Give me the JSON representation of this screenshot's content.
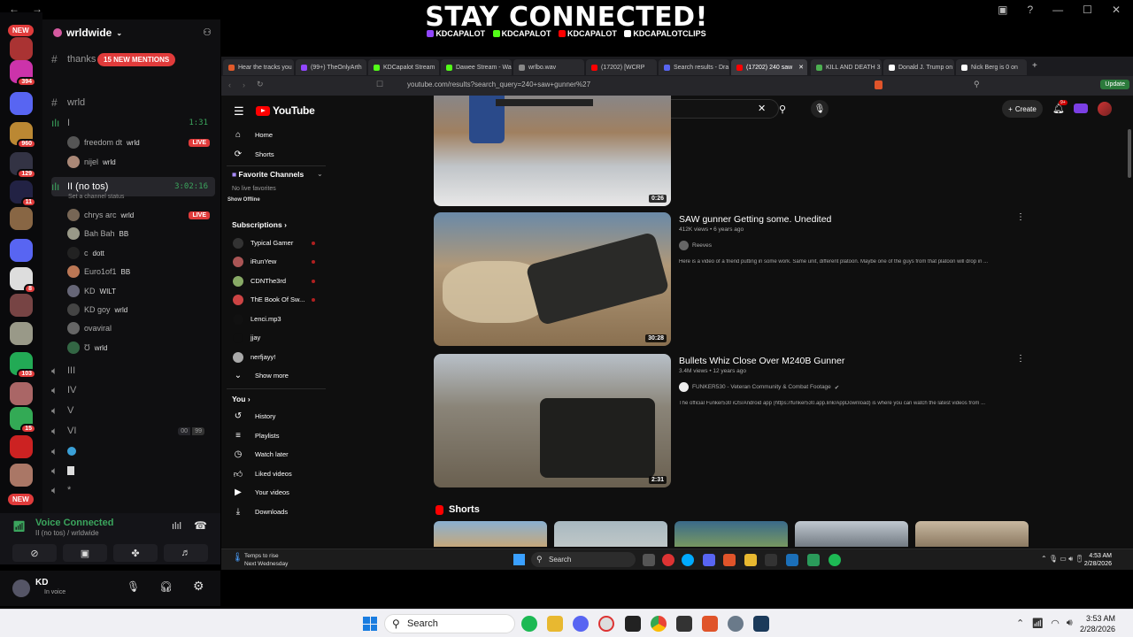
{
  "overlay": {
    "title": "STAY CONNECTED!",
    "socials": [
      {
        "label": "KDCAPALOT",
        "color": "#9146ff"
      },
      {
        "label": "KDCAPALOT",
        "color": "#53fc18"
      },
      {
        "label": "KDCAPALOT",
        "color": "#ff0000"
      },
      {
        "label": "KDCAPALOTCLIPS",
        "color": "#ffffff"
      }
    ]
  },
  "server_rail": {
    "new_top": "NEW",
    "new_bottom": "NEW",
    "badges": [
      "394",
      "960",
      "129",
      "11",
      "8",
      "103",
      "15"
    ]
  },
  "discord": {
    "server_name": "wrldwide",
    "mentions": "15 NEW MENTIONS",
    "channels": {
      "thanks": "thanks",
      "wrld": "wrld",
      "voice1": "I",
      "voice1_timer": "1:31",
      "voice2": "II (no tos)",
      "voice2_timer": "3:02:16",
      "voice2_status": "Set a channel status",
      "voice3": "III",
      "voice4": "IV",
      "voice5": "V",
      "voice6": "VI",
      "voice6_count": "00",
      "voice6_limit": "99",
      "voice8": "*"
    },
    "vc1_users": [
      {
        "name": "freedom dt",
        "tag": "wrld",
        "live": "LIVE"
      },
      {
        "name": "nijel",
        "tag": "wrld",
        "live": ""
      }
    ],
    "vc2_users": [
      {
        "name": "chrys arc",
        "tag": "wrld",
        "live": "LIVE"
      },
      {
        "name": "Bah Bah",
        "tag": "BB",
        "live": ""
      },
      {
        "name": "c",
        "tag": "dott",
        "live": ""
      },
      {
        "name": "Euro1of1",
        "tag": "BB",
        "live": ""
      },
      {
        "name": "KD",
        "tag": "WILT",
        "live": ""
      },
      {
        "name": "KD goy",
        "tag": "wrld",
        "live": ""
      },
      {
        "name": "ovaviral",
        "tag": "",
        "live": ""
      },
      {
        "name": "Ʊ",
        "tag": "wrld",
        "live": ""
      }
    ],
    "voice_connected": "Voice Connected",
    "voice_location": "II (no tos) / wrldwide",
    "user_name": "KD",
    "user_status": "In voice"
  },
  "browser": {
    "tabs": [
      {
        "label": "Hear the tracks you",
        "color": "#e05a2a"
      },
      {
        "label": "(99+) TheOnlyArth",
        "color": "#9146ff"
      },
      {
        "label": "KDCapalot Stream",
        "color": "#53fc18"
      },
      {
        "label": "Dawee Stream - Wa",
        "color": "#53fc18"
      },
      {
        "label": "wrlbo.wav",
        "color": "#888888"
      },
      {
        "label": "(17202) [WCRP",
        "color": "#ff0000"
      },
      {
        "label": "Search results - Dra",
        "color": "#5865f2"
      },
      {
        "label": "(17202) 240 saw",
        "color": "#ff0000"
      },
      {
        "label": "KILL AND DEATH 3",
        "color": "#4caf50"
      },
      {
        "label": "Donald J. Trump on",
        "color": "#ffffff"
      },
      {
        "label": "Nick Berg is 0 on",
        "color": "#ffffff"
      }
    ],
    "url": "youtube.com/results?search_query=240+saw+gunner%27",
    "update": "Update"
  },
  "youtube": {
    "logo": "YouTube",
    "search_value": "240 saw gunner'",
    "create": "Create",
    "bell_badge": "9+",
    "sidebar": {
      "home": "Home",
      "shorts": "Shorts",
      "favorite_channels": "Favorite Channels",
      "no_live": "No live favorites",
      "show_offline": "Show Offline",
      "subscriptions": "Subscriptions",
      "subs": [
        "Typical Gamer",
        "iRunYew",
        "CDNThe3rd",
        "ThE Book Of Sw...",
        "Lenci.mp3",
        "jjay",
        "nerfjayy!"
      ],
      "show_more": "Show more",
      "you": "You",
      "history": "History",
      "playlists": "Playlists",
      "watch_later": "Watch later",
      "liked": "Liked videos",
      "your_videos": "Your videos",
      "downloads": "Downloads"
    },
    "results": [
      {
        "title": "",
        "meta": "",
        "channel": "",
        "desc": "",
        "duration": "0:26"
      },
      {
        "title": "SAW gunner Getting some. Unedited",
        "meta": "412K views • 6 years ago",
        "channel": "Reeves",
        "desc": "Here is a video of a friend putting in some work. Same unit, different platoon. Maybe one of the guys from that platoon will drop in ...",
        "duration": "30:28"
      },
      {
        "title": "Bullets Whiz Close Over M240B Gunner",
        "meta": "3.4M views • 12 years ago",
        "channel": "FUNKER530 - Veteran Community & Combat Footage",
        "desc": "The official Funker530 iOS/Android app (https://funker530.app.link/AppDownload) is where you can watch the latest videos from ...",
        "duration": "2:31"
      }
    ],
    "shorts_label": "Shorts"
  },
  "inner_taskbar": {
    "weather_1": "Temps to rise",
    "weather_2": "Next Wednesday",
    "search": "Search",
    "time": "4:53 AM",
    "date": "2/28/2026"
  },
  "outer_taskbar": {
    "search": "Search",
    "time": "3:53 AM",
    "date": "2/28/2026"
  }
}
